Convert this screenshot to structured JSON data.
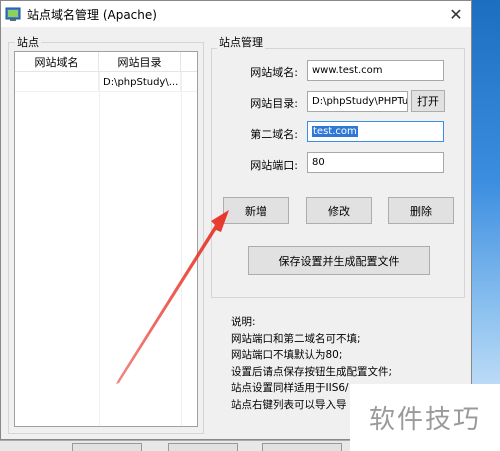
{
  "window": {
    "title": "站点域名管理 (Apache)",
    "close_glyph": "✕"
  },
  "sites_group": {
    "title": "站点",
    "columns": [
      "网站域名",
      "网站目录"
    ],
    "rows": [
      {
        "domain": "",
        "dir": "D:\\phpStudy\\..."
      }
    ]
  },
  "manage_group": {
    "title": "站点管理",
    "domain_label": "网站域名:",
    "domain_value": "www.test.com",
    "dir_label": "网站目录:",
    "dir_value": "D:\\phpStudy\\PHPTutor",
    "open_label": "打开",
    "second_label": "第二域名:",
    "second_value": "test.com",
    "port_label": "网站端口:",
    "port_value": "80",
    "add_label": "新增",
    "edit_label": "修改",
    "delete_label": "删除",
    "save_label": "保存设置并生成配置文件"
  },
  "notes": {
    "title": "说明:",
    "lines": [
      "网站端口和第二域名可不填;",
      "网站端口不填默认为80;",
      "设置后请点保存按钮生成配置文件;",
      "站点设置同样适用于IIS6/",
      "站点右键列表可以导入导"
    ]
  },
  "watermark": "软件技巧",
  "colors": {
    "arrow": "#e8362a",
    "selection": "#3078d8",
    "desktop": "#1b6cb8"
  }
}
